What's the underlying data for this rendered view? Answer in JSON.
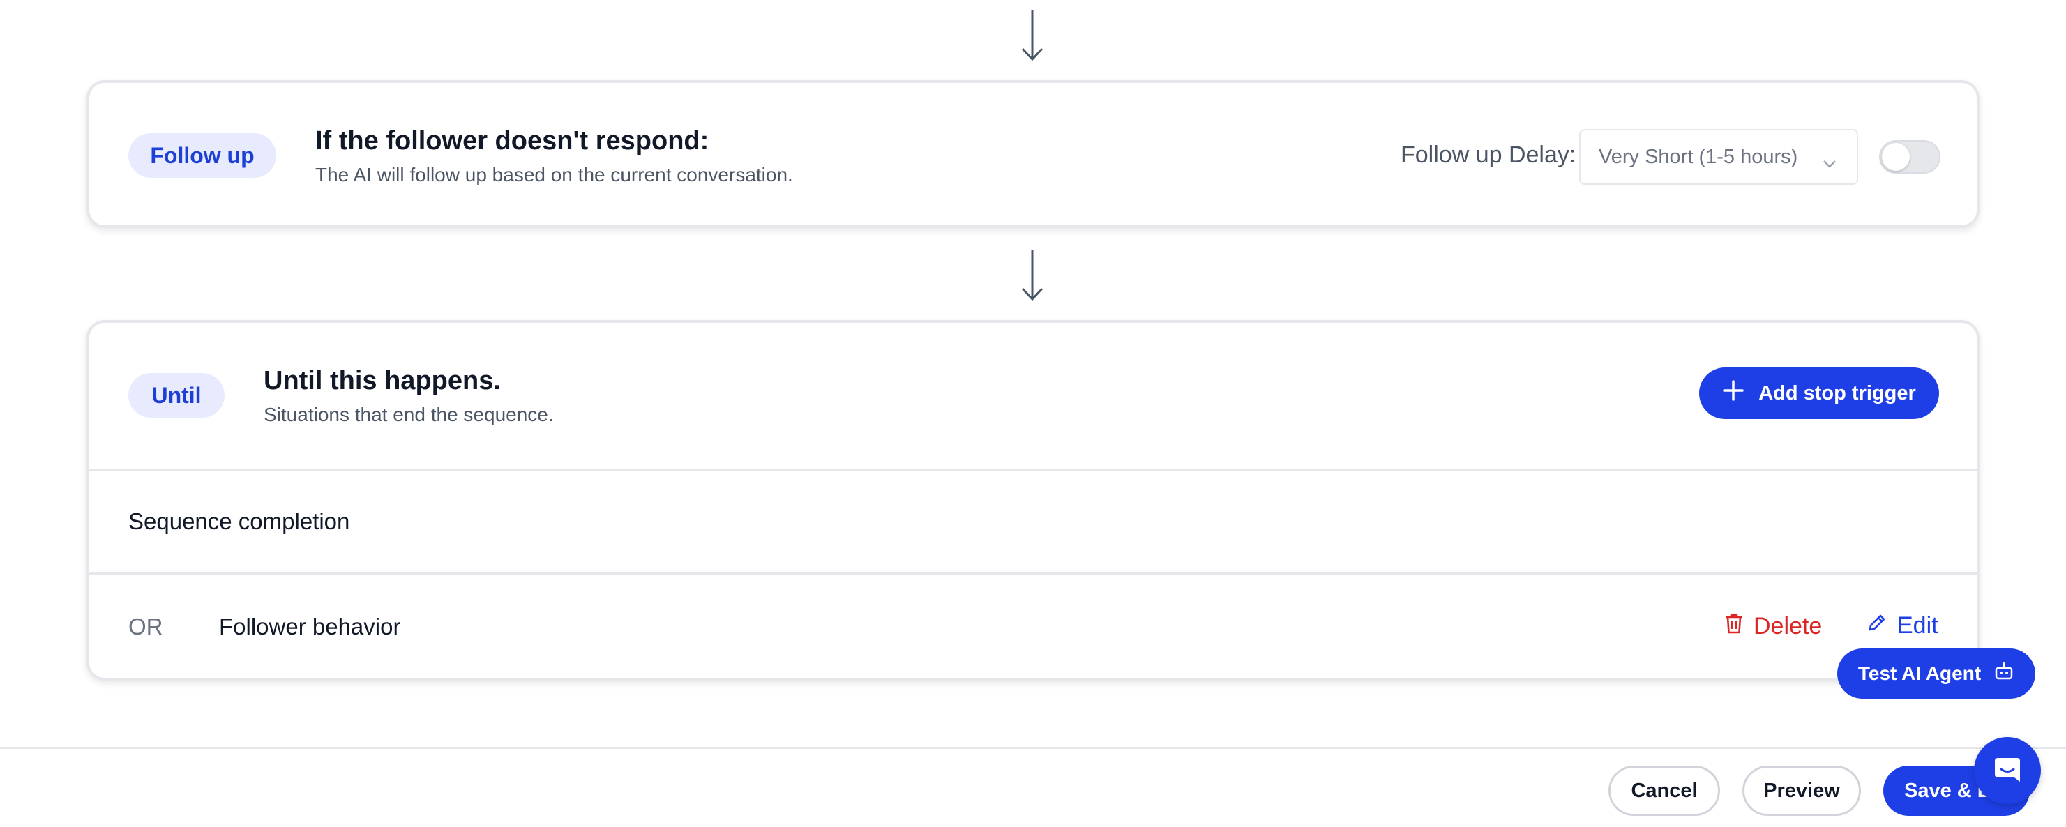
{
  "follow_up": {
    "pill": "Follow up",
    "title": "If the follower doesn't respond:",
    "description": "The AI will follow up based on the current conversation.",
    "delay_label": "Follow up Delay:",
    "delay_value": "Very Short (1-5 hours)",
    "enabled": false
  },
  "until": {
    "pill": "Until",
    "title": "Until this happens.",
    "description": "Situations that end the sequence.",
    "add_button": "Add stop trigger",
    "rows": {
      "completion": "Sequence completion",
      "or_label": "OR",
      "behavior": "Follower behavior"
    },
    "delete_label": "Delete",
    "edit_label": "Edit"
  },
  "test_agent_label": "Test AI Agent",
  "footer": {
    "cancel": "Cancel",
    "preview": "Preview",
    "save": "Save & E"
  },
  "colors": {
    "primary": "#1f3fe6",
    "pill_bg": "#e8ebfd",
    "danger": "#dc2626",
    "border": "#e5e7eb"
  },
  "icons": [
    "arrow-down-icon",
    "chevron-down-icon",
    "plus-icon",
    "trash-icon",
    "pencil-icon",
    "robot-icon",
    "chat-icon"
  ]
}
